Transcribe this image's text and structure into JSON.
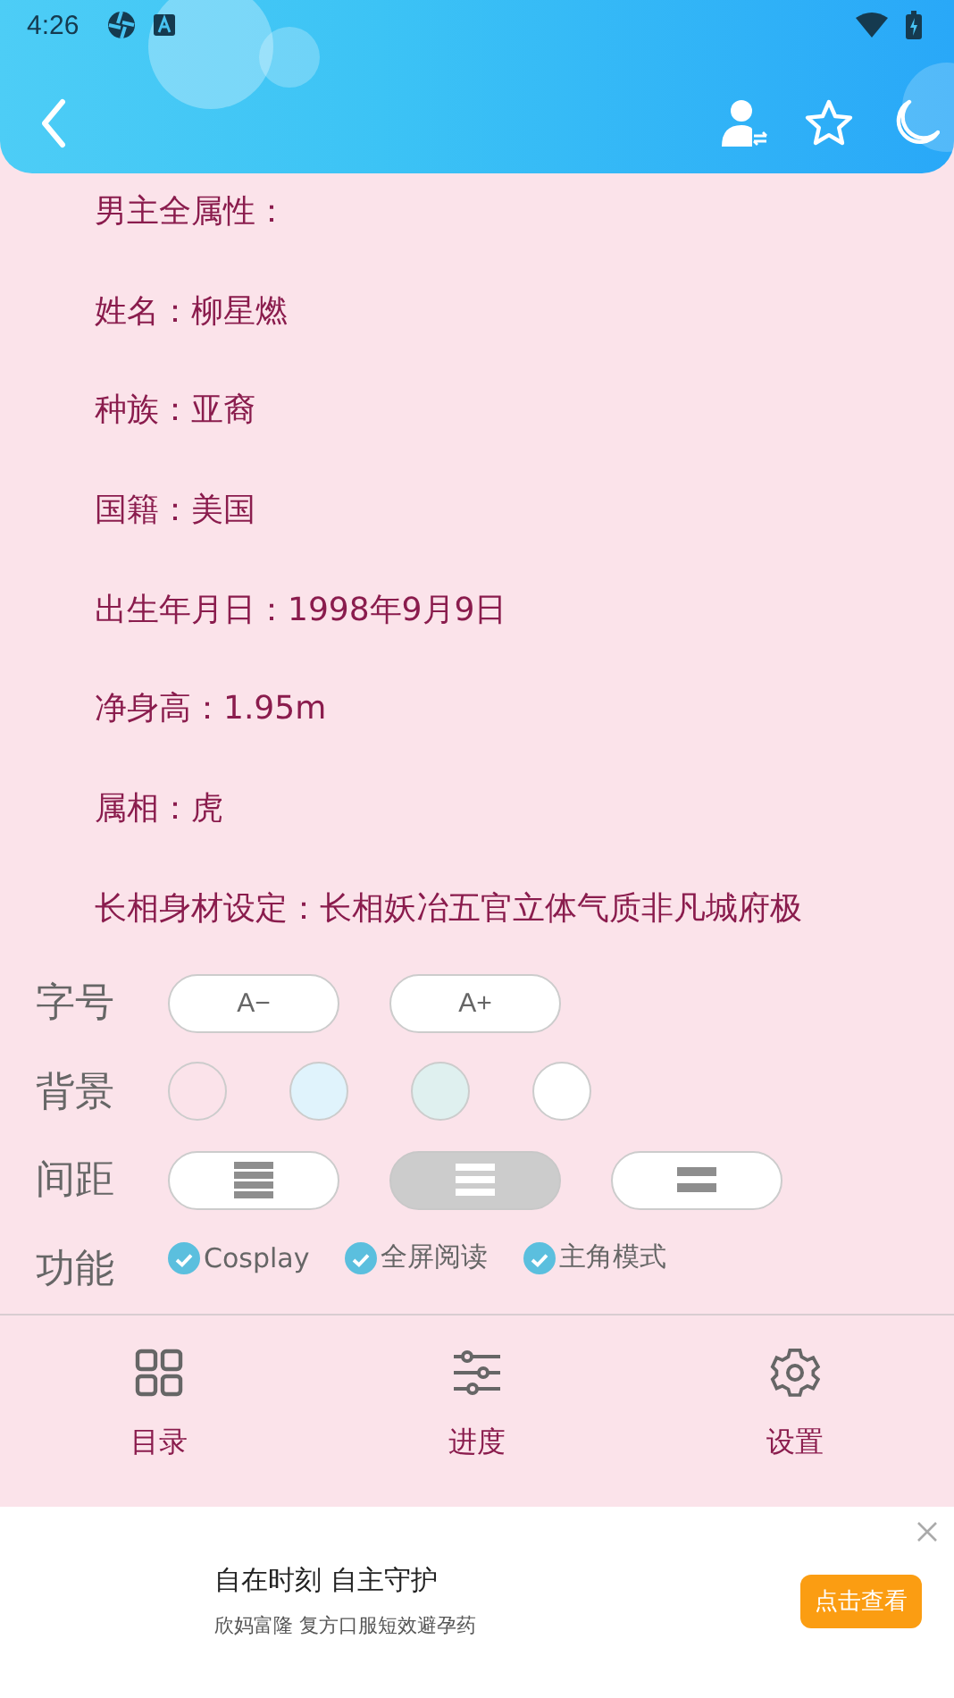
{
  "status_bar": {
    "time": "4:26"
  },
  "paragraphs": [
    "男主全属性：",
    "姓名：柳星燃",
    "种族：亚裔",
    "国籍：美国",
    "出生年月日：1998年9月9日",
    "净身高：1.95m",
    "属相：虎",
    "长相身材设定：长相妖冶五官立体气质非凡城府极"
  ],
  "settings": {
    "font_size": {
      "label": "字号",
      "buttons": [
        "A−",
        "A+"
      ]
    },
    "background": {
      "label": "背景",
      "swatches": [
        {
          "color": "#fbe3ea"
        },
        {
          "color": "#e0f3fc"
        },
        {
          "color": "#dff0ef"
        },
        {
          "color": "#ffffff"
        }
      ]
    },
    "spacing": {
      "label": "间距",
      "options": [
        {
          "kind": "tight",
          "selected": false
        },
        {
          "kind": "medium",
          "selected": true
        },
        {
          "kind": "loose",
          "selected": false
        }
      ]
    },
    "features": {
      "label": "功能",
      "items": [
        {
          "label": "Cosplay",
          "checked": true
        },
        {
          "label": "全屏阅读",
          "checked": true
        },
        {
          "label": "主角模式",
          "checked": true
        }
      ]
    }
  },
  "bottom_nav": [
    {
      "kind": "grid",
      "label": "目录"
    },
    {
      "kind": "sliders",
      "label": "进度"
    },
    {
      "kind": "gear",
      "label": "设置"
    }
  ],
  "ad": {
    "title": "自在时刻 自主守护",
    "subtitle": "欣妈富隆 复方口服短效避孕药",
    "button": "点击查看"
  }
}
